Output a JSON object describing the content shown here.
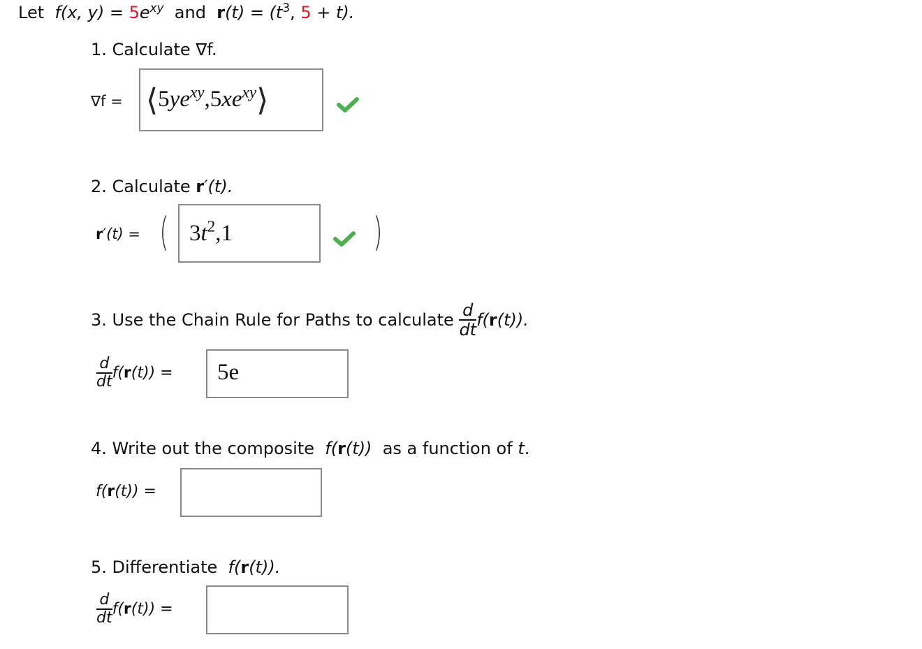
{
  "header": {
    "let": "Let",
    "f_def_lhs": "f(x, y) =",
    "f_coef": "5",
    "f_base": "e",
    "f_exp": "xy",
    "and": "and",
    "r_bold": "r",
    "r_arg": "(t) = (t",
    "r_exp": "3",
    "r_comma": ",",
    "r_const": "5",
    "r_tail": "+ t)."
  },
  "q1": {
    "prompt": "1. Calculate ∇f.",
    "label": "∇f =",
    "answer": "⟨5ye^xy,5xe^xy⟩",
    "answer_parts": [
      "5",
      "y",
      "e",
      "xy",
      ",5",
      "x",
      "e",
      "xy"
    ],
    "status": "correct",
    "status_icon": "check-icon"
  },
  "q2": {
    "prompt_text": "2. Calculate",
    "prompt_math_bold": "r",
    "prompt_math_rest": "′(t).",
    "label_bold": "r",
    "label_rest": "′(t) =",
    "answer": "3t^2,1",
    "answer_parts": [
      "3",
      "t",
      "2",
      ",1"
    ],
    "status": "correct",
    "status_icon": "check-icon"
  },
  "q3": {
    "prompt_text": "3. Use the Chain Rule for Paths to calculate",
    "frac_num": "d",
    "frac_den": "dt",
    "prompt_f": "f(",
    "prompt_bold": "r",
    "prompt_tail": "(t)).",
    "label_f": "f(",
    "label_bold": "r",
    "label_tail": "(t)) =",
    "answer": "5e"
  },
  "q4": {
    "prompt_text": "4. Write out the composite",
    "prompt_f": "f(",
    "prompt_bold": "r",
    "prompt_tail": "(t))",
    "prompt_suffix": "as a function of",
    "prompt_var": "t",
    "prompt_end": ".",
    "label_f": "f(",
    "label_bold": "r",
    "label_tail": "(t)) =",
    "answer": ""
  },
  "q5": {
    "prompt_text": "5. Differentiate",
    "prompt_f": "f(",
    "prompt_bold": "r",
    "prompt_tail": "(t)).",
    "frac_num": "d",
    "frac_den": "dt",
    "label_f": "f(",
    "label_bold": "r",
    "label_tail": "(t)) =",
    "answer": ""
  },
  "colors": {
    "accent_red": "#e8141a",
    "check_green": "#4caf50",
    "box_border": "#8a8a8a"
  }
}
